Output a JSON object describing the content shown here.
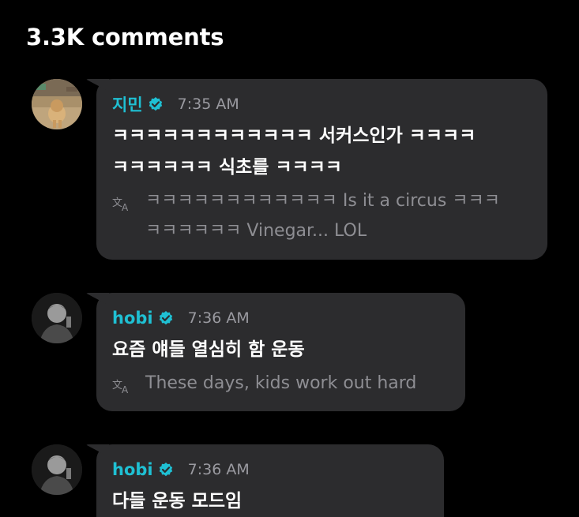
{
  "header": {
    "title": "3.3K comments"
  },
  "colors": {
    "author": "#1fc0d3",
    "bubble": "#2c2c2e",
    "background": "#000000"
  },
  "comments": [
    {
      "author": "지민",
      "time": "7:35 AM",
      "text": "ㅋㅋㅋㅋㅋㅋㅋㅋㅋㅋㅋㅋ 서커스인가 ㅋㅋㅋㅋ\nㅋㅋㅋㅋㅋㅋ 식초를 ㅋㅋㅋㅋ",
      "translation": "ㅋㅋㅋㅋㅋㅋㅋㅋㅋㅋㅋㅋ Is it a circus ㅋㅋㅋ\nㅋㅋㅋㅋㅋㅋ Vinegar... LOL",
      "avatar_icon": "dog-photo-avatar",
      "verified_icon": "verified-badge-icon"
    },
    {
      "author": "hobi",
      "time": "7:36 AM",
      "text": "요즘 얘들 열심히 함 운동",
      "translation": "These days, kids work out hard",
      "avatar_icon": "person-photo-avatar",
      "verified_icon": "verified-badge-icon"
    },
    {
      "author": "hobi",
      "time": "7:36 AM",
      "text": "다들 운동 모드임",
      "avatar_icon": "person-photo-avatar",
      "verified_icon": "verified-badge-icon"
    }
  ]
}
